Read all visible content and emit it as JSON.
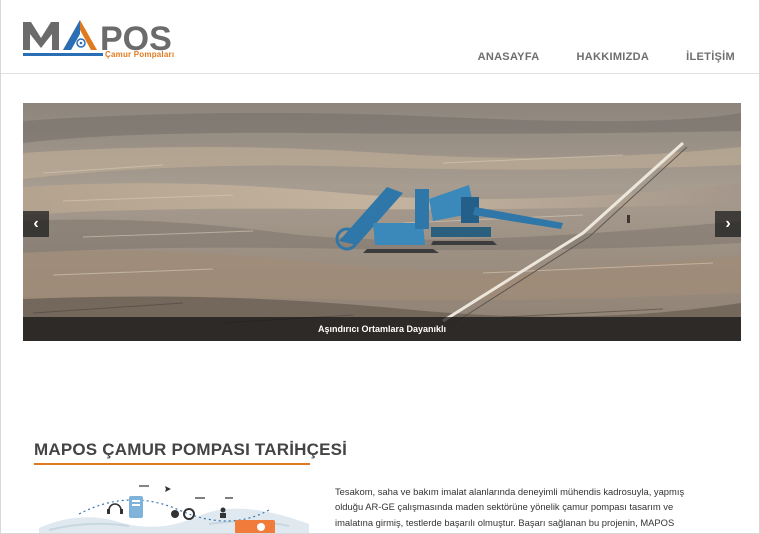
{
  "logo": {
    "word": "MAPOS",
    "subtitle": "Çamur Pompaları",
    "colors": {
      "gray": "#6b6b6b",
      "orange": "#e07a1f",
      "blue": "#2a6fb5"
    }
  },
  "nav": {
    "items": [
      {
        "label": "ANASAYFA"
      },
      {
        "label": "HAKKIMIZDA"
      },
      {
        "label": "İLETİŞİM"
      }
    ]
  },
  "slider": {
    "caption": "Aşındırıcı Ortamlara Dayanıklı",
    "prev_icon": "chevron-left-icon",
    "next_icon": "chevron-right-icon",
    "prev_glyph": "‹",
    "next_glyph": "›"
  },
  "history": {
    "title": "MAPOS ÇAMUR POMPASI TARİHÇESİ",
    "text": "Tesakom, saha ve bakım imalat alanlarında deneyimli mühendis kadrosuyla, yapmış olduğu AR-GE çalışmasında maden sektörüne yönelik çamur pompası tasarım ve imalatına girmiş, testlerde başarılı olmuştur. Başarı sağlanan bu projenin, MAPOS"
  }
}
